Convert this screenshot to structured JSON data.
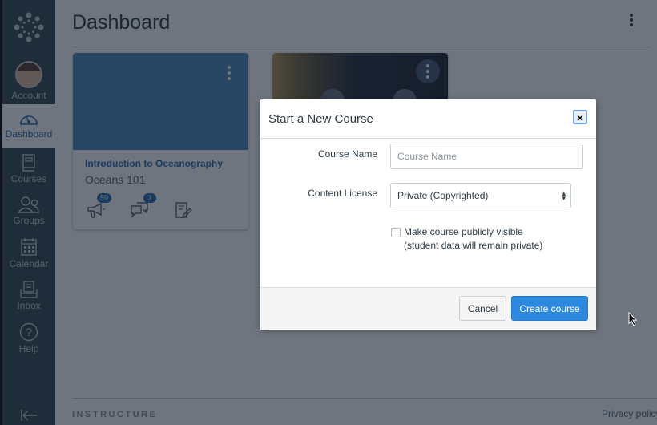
{
  "sidebar": {
    "items": [
      {
        "label": "Account",
        "icon": "avatar"
      },
      {
        "label": "Dashboard",
        "icon": "dashboard-icon",
        "active": true
      },
      {
        "label": "Courses",
        "icon": "courses-icon"
      },
      {
        "label": "Groups",
        "icon": "groups-icon"
      },
      {
        "label": "Calendar",
        "icon": "calendar-icon"
      },
      {
        "label": "Inbox",
        "icon": "inbox-icon"
      },
      {
        "label": "Help",
        "icon": "help-icon"
      }
    ],
    "collapse_icon": "collapse-icon"
  },
  "header": {
    "title": "Dashboard"
  },
  "cards": [
    {
      "title": "Introduction to Oceanography",
      "subtitle": "Oceans 101",
      "color": "#5089bd",
      "announcements_badge": "59",
      "discussions_badge": "3"
    },
    {
      "title": "",
      "subtitle": "",
      "image": "planets"
    }
  ],
  "footer": {
    "brand": "INSTRUCTURE",
    "privacy": "Privacy policy"
  },
  "modal": {
    "title": "Start a New Course",
    "close_label": "×",
    "course_name_label": "Course Name",
    "course_name_placeholder": "Course Name",
    "course_name_value": "",
    "license_label": "Content License",
    "license_value": "Private (Copyrighted)",
    "public_label_line1": "Make course publicly visible",
    "public_label_line2": "(student data will remain private)",
    "public_checked": false,
    "cancel_label": "Cancel",
    "create_label": "Create course"
  },
  "colors": {
    "sidebar": "#394b58",
    "accent": "#2d6fb0",
    "primary_button": "#2d88e0"
  }
}
